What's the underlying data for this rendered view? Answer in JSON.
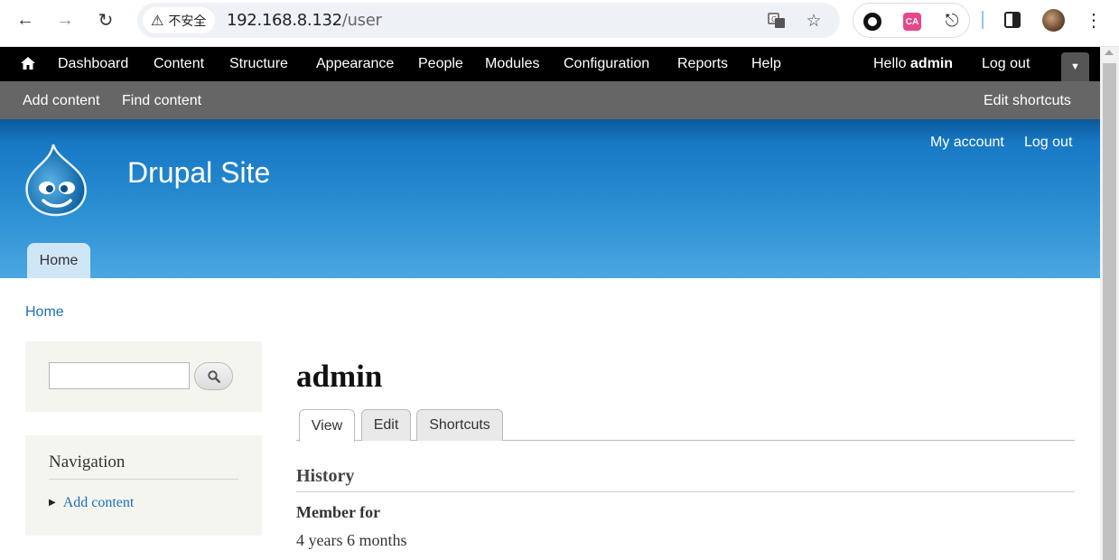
{
  "browser": {
    "security_label": "不安全",
    "url_host": "192.168.8.132",
    "url_path": "/user"
  },
  "toolbar": {
    "items": [
      "Dashboard",
      "Content",
      "Structure",
      "Appearance",
      "People",
      "Modules",
      "Configuration",
      "Reports",
      "Help"
    ],
    "hello": "Hello",
    "user": "admin",
    "logout": "Log out"
  },
  "shortcuts": {
    "add_content": "Add content",
    "find_content": "Find content",
    "edit_shortcuts": "Edit shortcuts"
  },
  "header": {
    "site_name": "Drupal Site",
    "my_account": "My account",
    "log_out": "Log out",
    "home_tab": "Home"
  },
  "breadcrumb": "Home",
  "sidebar": {
    "search_value": "",
    "navigation_title": "Navigation",
    "nav_items": [
      "Add content"
    ]
  },
  "main": {
    "title": "admin",
    "tabs": [
      "View",
      "Edit",
      "Shortcuts"
    ],
    "section_title": "History",
    "member_label": "Member for",
    "member_value": "4 years 6 months"
  },
  "colors": {
    "toolbar_bg": "#000000",
    "shortcuts_bg": "#666666",
    "header_blue": "#2a8ed2",
    "link_blue": "#1a6eb8"
  }
}
